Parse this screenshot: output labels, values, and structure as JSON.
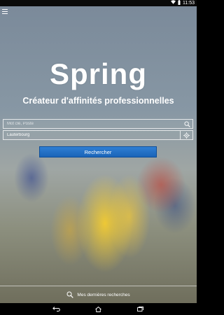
{
  "status_bar": {
    "time": "11:53",
    "icons": [
      "screenshot-icon",
      "notification-icon",
      "photo-icon",
      "wifi-icon",
      "battery-icon"
    ]
  },
  "app": {
    "logo": "Spring",
    "tagline": "Créateur d'affinités professionnelles"
  },
  "search": {
    "keyword_placeholder": "Mot clé, Poste",
    "keyword_value": "",
    "location_value": "Lauterbourg",
    "submit_label": "Rechercher"
  },
  "recent": {
    "label": "Mes dernières recherches"
  },
  "colors": {
    "accent": "#1f6cc2",
    "text": "#ffffff"
  }
}
